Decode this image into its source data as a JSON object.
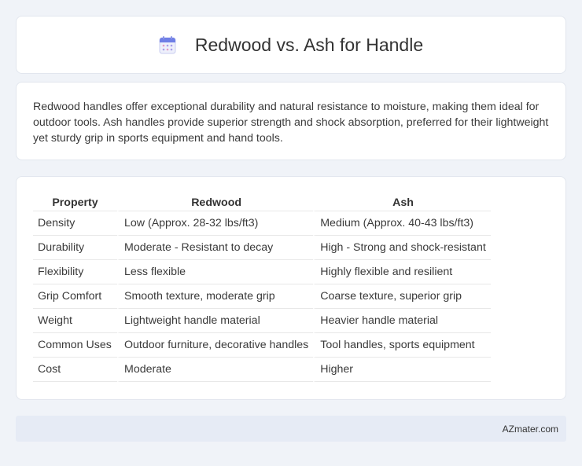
{
  "header": {
    "icon": "calendar-icon",
    "title": "Redwood vs. Ash for Handle"
  },
  "intro": {
    "text": "Redwood handles offer exceptional durability and natural resistance to moisture, making them ideal for outdoor tools. Ash handles provide superior strength and shock absorption, preferred for their lightweight yet sturdy grip in sports equipment and hand tools."
  },
  "table": {
    "headers": [
      "Property",
      "Redwood",
      "Ash"
    ],
    "rows": [
      [
        "Density",
        "Low (Approx. 28-32 lbs/ft3)",
        "Medium (Approx. 40-43 lbs/ft3)"
      ],
      [
        "Durability",
        "Moderate - Resistant to decay",
        "High - Strong and shock-resistant"
      ],
      [
        "Flexibility",
        "Less flexible",
        "Highly flexible and resilient"
      ],
      [
        "Grip Comfort",
        "Smooth texture, moderate grip",
        "Coarse texture, superior grip"
      ],
      [
        "Weight",
        "Lightweight handle material",
        "Heavier handle material"
      ],
      [
        "Common Uses",
        "Outdoor furniture, decorative handles",
        "Tool handles, sports equipment"
      ],
      [
        "Cost",
        "Moderate",
        "Higher"
      ]
    ]
  },
  "footer": {
    "text": "AZmater.com"
  }
}
